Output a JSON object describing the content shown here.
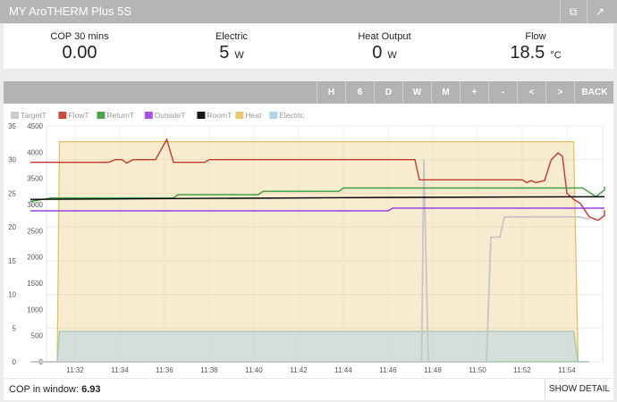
{
  "header": {
    "title": "MY AroTHERM Plus 5S",
    "edit_icon": "external-edit-icon",
    "config_icon": "wrench-icon"
  },
  "stats": [
    {
      "label": "COP 30 mins",
      "value": "0.00",
      "unit": ""
    },
    {
      "label": "Electric",
      "value": "5",
      "unit": "W"
    },
    {
      "label": "Heat Output",
      "value": "0",
      "unit": "W"
    },
    {
      "label": "Flow",
      "value": "18.5",
      "unit": "°C"
    }
  ],
  "toolbar": [
    "H",
    "6",
    "D",
    "W",
    "M",
    "+",
    "-",
    "<",
    ">",
    "BACK"
  ],
  "footer": {
    "cop_label": "COP in window:",
    "cop_value": "6.93",
    "show_detail": "SHOW DETAIL"
  },
  "chart_data": {
    "type": "line",
    "legend": [
      {
        "name": "TargetT",
        "color": "#c6c6c6"
      },
      {
        "name": "FlowT",
        "color": "#c0392b"
      },
      {
        "name": "ReturnT",
        "color": "#3a9a3a"
      },
      {
        "name": "OutsideT",
        "color": "#9b40e0"
      },
      {
        "name": "RoomT",
        "color": "#000000"
      },
      {
        "name": "Heat",
        "color": "#e8c062"
      },
      {
        "name": "Electric",
        "color": "#a9cfe9"
      }
    ],
    "legend_placement": "top-left",
    "x_ticks": [
      "11:32",
      "11:34",
      "11:36",
      "11:38",
      "11:40",
      "11:42",
      "11:44",
      "11:46",
      "11:48",
      "11:50",
      "11:52",
      "11:54"
    ],
    "y_left_ticks": [
      35,
      30,
      25,
      20,
      15,
      10,
      5,
      0
    ],
    "y_right_ticks": [
      4500,
      4000,
      3500,
      3000,
      2500,
      2000,
      1500,
      1000,
      500,
      0
    ],
    "xlim": [
      "11:30",
      "11:55"
    ],
    "ylim_temp": [
      0,
      35
    ],
    "ylim_power": [
      0,
      4500
    ],
    "series": [
      {
        "name": "Heat",
        "axis": "power",
        "points": [
          [
            "11:30",
            0
          ],
          [
            "11:31.2",
            0
          ],
          [
            "11:31.3",
            4200
          ],
          [
            "11:54.3",
            4200
          ],
          [
            "11:54.5",
            0
          ],
          [
            "11:55",
            0
          ]
        ]
      },
      {
        "name": "Electric",
        "axis": "power",
        "points": [
          [
            "11:30",
            0
          ],
          [
            "11:31.2",
            0
          ],
          [
            "11:31.3",
            580
          ],
          [
            "11:54.3",
            580
          ],
          [
            "11:54.5",
            0
          ],
          [
            "11:55",
            0
          ]
        ]
      },
      {
        "name": "TargetT",
        "axis": "temp",
        "points": [
          [
            "11:30",
            0
          ],
          [
            "11:47.5",
            0
          ],
          [
            "11:47.6",
            30
          ],
          [
            "11:47.8",
            0
          ],
          [
            "11:50.4",
            0
          ],
          [
            "11:50.6",
            18.5
          ],
          [
            "11:51",
            18.5
          ],
          [
            "11:51.2",
            21.5
          ],
          [
            "11:54.5",
            21.5
          ],
          [
            "11:55",
            21.2
          ]
        ]
      },
      {
        "name": "FlowT",
        "axis": "temp",
        "points": [
          [
            "11:30",
            29.6
          ],
          [
            "11:32.5",
            29.6
          ],
          [
            "11:33.5",
            29.6
          ],
          [
            "11:33.8",
            30.0
          ],
          [
            "11:34.1",
            30.0
          ],
          [
            "11:34.3",
            29.5
          ],
          [
            "11:34.6",
            30.0
          ],
          [
            "11:35.6",
            30.0
          ],
          [
            "11:36.1",
            33.0
          ],
          [
            "11:36.4",
            29.6
          ],
          [
            "11:37.8",
            29.6
          ],
          [
            "11:38.0",
            30.0
          ],
          [
            "11:47.2",
            30.0
          ],
          [
            "11:47.4",
            27.0
          ],
          [
            "11:52.0",
            27.0
          ],
          [
            "11:52.2",
            26.6
          ],
          [
            "11:52.4",
            26.9
          ],
          [
            "11:52.6",
            26.6
          ],
          [
            "11:53.0",
            26.9
          ],
          [
            "11:53.3",
            30.0
          ],
          [
            "11:53.6",
            31.0
          ],
          [
            "11:53.8",
            30.5
          ],
          [
            "11:54.0",
            25.0
          ],
          [
            "11:54.3",
            24.1
          ],
          [
            "11:54.6",
            23.5
          ],
          [
            "11:55",
            21.5
          ],
          [
            "11:55.4",
            21.0
          ],
          [
            "11:55.8",
            21.7
          ],
          [
            "11:56.1",
            22.5
          ]
        ]
      },
      {
        "name": "ReturnT",
        "axis": "temp",
        "points": [
          [
            "11:30",
            23.8
          ],
          [
            "11:30.9",
            24.3
          ],
          [
            "11:36.4",
            24.3
          ],
          [
            "11:36.6",
            24.8
          ],
          [
            "11:40.2",
            24.8
          ],
          [
            "11:40.4",
            25.3
          ],
          [
            "11:43.8",
            25.3
          ],
          [
            "11:44.0",
            25.8
          ],
          [
            "11:54.7",
            25.8
          ],
          [
            "11:55.3",
            24.5
          ],
          [
            "11:55.8",
            25.5
          ],
          [
            "11:56.1",
            26.0
          ]
        ]
      },
      {
        "name": "OutsideT",
        "axis": "temp",
        "points": [
          [
            "11:30",
            22.4
          ],
          [
            "11:46.0",
            22.4
          ],
          [
            "11:46.2",
            22.8
          ],
          [
            "11:56.1",
            22.8
          ]
        ]
      },
      {
        "name": "RoomT",
        "axis": "temp",
        "points": [
          [
            "11:30",
            24.1
          ],
          [
            "11:46",
            24.4
          ],
          [
            "11:56.1",
            24.5
          ]
        ]
      }
    ]
  }
}
